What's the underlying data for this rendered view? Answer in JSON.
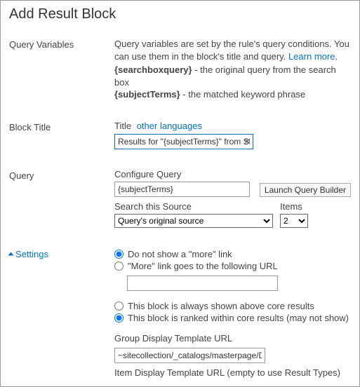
{
  "title": "Add Result Block",
  "rows": {
    "queryVariables": {
      "sideLabel": "Query Variables",
      "help": "Query variables are set by the rule's query conditions. You can use them in the block's title and query.",
      "learnMore": "Learn more",
      "vars": [
        {
          "name": "{searchboxquery}",
          "desc": " - the original query from the search box"
        },
        {
          "name": "{subjectTerms}",
          "desc": " - the matched keyword phrase"
        }
      ]
    },
    "blockTitle": {
      "sideLabel": "Block Title",
      "fieldLabel": "Title",
      "otherLanguages": "other languages",
      "value": "Results for \"{subjectTerms}\" from SharePoint"
    },
    "query": {
      "sideLabel": "Query",
      "configureLabel": "Configure Query",
      "configureValue": "{subjectTerms}",
      "launchBtn": "Launch Query Builder",
      "sourceLabel": "Search this Source",
      "sourceSelected": "Query's original source",
      "itemsLabel": "Items",
      "itemsSelected": "2"
    },
    "settings": {
      "link": "Settings",
      "moreRadios": {
        "noMore": "Do not show a \"more\" link",
        "moreUrl": "\"More\" link goes to the following URL",
        "urlValue": ""
      },
      "posRadios": {
        "above": "This block is always shown above core results",
        "ranked": "This block is ranked within core results (may not show)"
      },
      "groupDisplayTemplateLabel": "Group Display Template URL",
      "groupDisplayTemplateValue": "~sitecollection/_catalogs/masterpage/Display Templates",
      "itemDisplayTemplateLabel": "Item Display Template URL (empty to use Result Types)"
    }
  }
}
